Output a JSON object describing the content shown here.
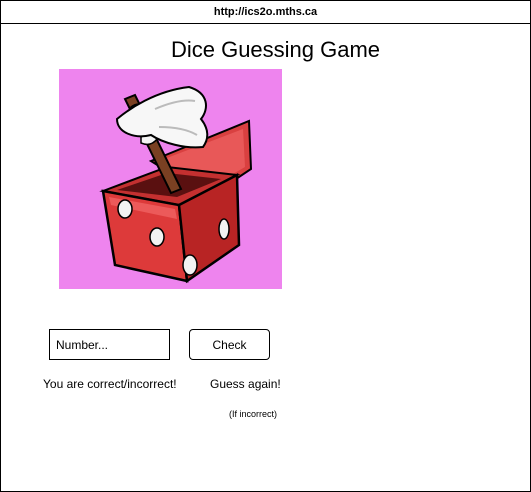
{
  "browser": {
    "url": "http://ics2o.mths.ca"
  },
  "page": {
    "title": "Dice Guessing Game"
  },
  "image": {
    "background_color": "#ee84ee",
    "icon": "dice-with-axe-image"
  },
  "form": {
    "input_placeholder": "Number...",
    "input_value": "",
    "check_label": "Check"
  },
  "feedback": {
    "result": "You are correct/incorrect!",
    "guess_again": "Guess again!",
    "if_incorrect": "(If incorrect)"
  }
}
